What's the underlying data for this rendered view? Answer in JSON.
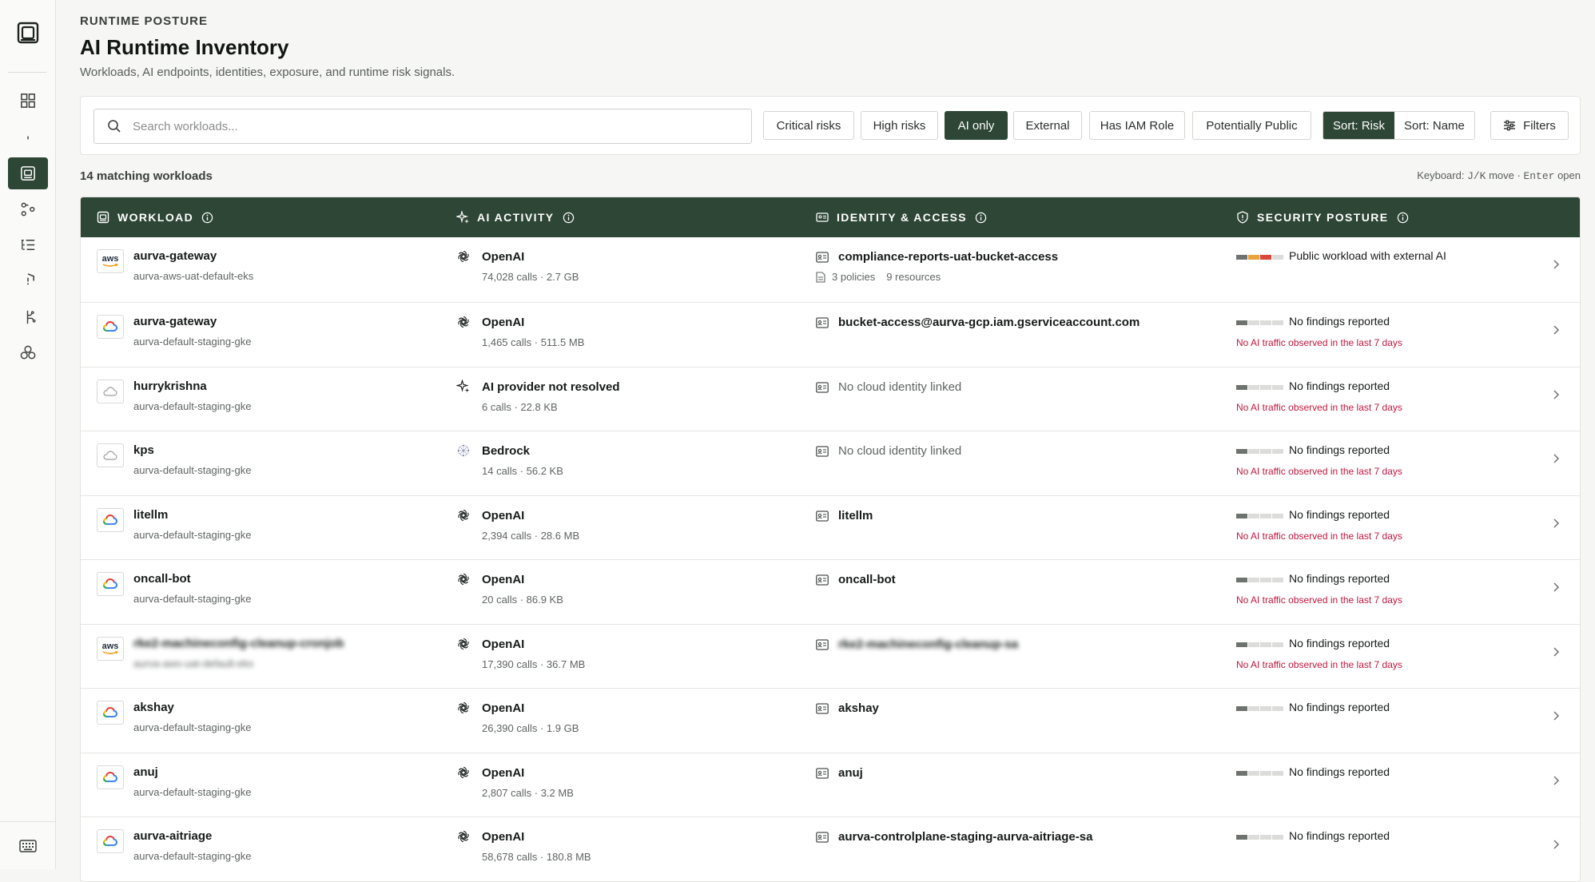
{
  "header": {
    "eyebrow": "RUNTIME POSTURE",
    "title": "AI Runtime Inventory",
    "subtitle": "Workloads, AI endpoints, identities, exposure, and runtime risk signals."
  },
  "search": {
    "placeholder": "Search workloads..."
  },
  "filters": [
    {
      "label": "Critical risks",
      "active": false
    },
    {
      "label": "High risks",
      "active": false
    },
    {
      "label": "AI only",
      "active": true
    },
    {
      "label": "External",
      "active": false
    },
    {
      "label": "Has IAM Role",
      "active": false
    },
    {
      "label": "Potentially Public",
      "active": false
    }
  ],
  "sort": {
    "risk_label": "Sort: Risk",
    "name_label": "Sort: Name",
    "active": "risk"
  },
  "filters_button": "Filters",
  "count_text": "14 matching workloads",
  "keyboard": {
    "prefix": "Keyboard: ",
    "keys": "J/K",
    "move": " move · ",
    "enter": "Enter",
    "open": " open"
  },
  "columns": {
    "workload": "WORKLOAD",
    "ai_activity": "AI ACTIVITY",
    "identity": "IDENTITY & ACCESS",
    "posture": "SECURITY POSTURE"
  },
  "colors": {
    "accent": "#2e4636",
    "warn": "#c0173f",
    "sev_red": "#d9463a",
    "sev_orange": "#e8a33c",
    "sev_dark": "#6e7370"
  },
  "rows": [
    {
      "provider": "aws",
      "name": "aurva-gateway",
      "cluster": "aurva-aws-uat-default-eks",
      "ai_icon": "openai-icon",
      "ai_name": "OpenAI",
      "ai_sub": "74,028 calls · 2.7 GB",
      "identity": "compliance-reports-uat-bucket-access",
      "identity_style": "bold",
      "policies": "3 policies",
      "resources": "9 resources",
      "severity": [
        "dark",
        "orange",
        "red",
        "light"
      ],
      "posture": "Public workload with external AI",
      "warn": ""
    },
    {
      "provider": "gcp",
      "name": "aurva-gateway",
      "cluster": "aurva-default-staging-gke",
      "ai_icon": "openai-icon",
      "ai_name": "OpenAI",
      "ai_sub": "1,465 calls · 511.5 MB",
      "identity": "bucket-access@aurva-gcp.iam.gserviceaccount.com",
      "identity_style": "bold",
      "severity": [
        "dark",
        "light",
        "light",
        "light"
      ],
      "posture": "No findings reported",
      "warn": "No AI traffic observed in the last 7 days"
    },
    {
      "provider": "cloud",
      "name": "hurrykrishna",
      "cluster": "aurva-default-staging-gke",
      "ai_icon": "sparkle-icon",
      "ai_name": "AI provider not resolved",
      "ai_sub": "6 calls · 22.8 KB",
      "identity": "No cloud identity linked",
      "identity_style": "muted",
      "severity": [
        "dark",
        "light",
        "light",
        "light"
      ],
      "posture": "No findings reported",
      "warn": "No AI traffic observed in the last 7 days"
    },
    {
      "provider": "cloud",
      "name": "kps",
      "cluster": "aurva-default-staging-gke",
      "ai_icon": "bedrock-icon",
      "ai_name": "Bedrock",
      "ai_sub": "14 calls · 56.2 KB",
      "identity": "No cloud identity linked",
      "identity_style": "muted",
      "severity": [
        "dark",
        "light",
        "light",
        "light"
      ],
      "posture": "No findings reported",
      "warn": "No AI traffic observed in the last 7 days"
    },
    {
      "provider": "gcp",
      "name": "litellm",
      "cluster": "aurva-default-staging-gke",
      "ai_icon": "openai-icon",
      "ai_name": "OpenAI",
      "ai_sub": "2,394 calls · 28.6 MB",
      "identity": "litellm",
      "identity_style": "bold",
      "severity": [
        "dark",
        "light",
        "light",
        "light"
      ],
      "posture": "No findings reported",
      "warn": "No AI traffic observed in the last 7 days"
    },
    {
      "provider": "gcp",
      "name": "oncall-bot",
      "cluster": "aurva-default-staging-gke",
      "ai_icon": "openai-icon",
      "ai_name": "OpenAI",
      "ai_sub": "20 calls · 86.9 KB",
      "identity": "oncall-bot",
      "identity_style": "bold",
      "severity": [
        "dark",
        "light",
        "light",
        "light"
      ],
      "posture": "No findings reported",
      "warn": "No AI traffic observed in the last 7 days"
    },
    {
      "provider": "aws",
      "name": "rke2-machineconfig-cleanup-cronjob",
      "cluster": "aurva-aws-uat-default-eks",
      "blurred": true,
      "ai_icon": "openai-icon",
      "ai_name": "OpenAI",
      "ai_sub": "17,390 calls · 36.7 MB",
      "identity": "rke2-machineconfig-cleanup-sa",
      "identity_style": "bold",
      "severity": [
        "dark",
        "light",
        "light",
        "light"
      ],
      "posture": "No findings reported",
      "warn": "No AI traffic observed in the last 7 days"
    },
    {
      "provider": "gcp",
      "name": "akshay",
      "cluster": "aurva-default-staging-gke",
      "ai_icon": "openai-icon",
      "ai_name": "OpenAI",
      "ai_sub": "26,390 calls · 1.9 GB",
      "identity": "akshay",
      "identity_style": "bold",
      "severity": [
        "dark",
        "light",
        "light",
        "light"
      ],
      "posture": "No findings reported",
      "warn": ""
    },
    {
      "provider": "gcp",
      "name": "anuj",
      "cluster": "aurva-default-staging-gke",
      "ai_icon": "openai-icon",
      "ai_name": "OpenAI",
      "ai_sub": "2,807 calls · 3.2 MB",
      "identity": "anuj",
      "identity_style": "bold",
      "severity": [
        "dark",
        "light",
        "light",
        "light"
      ],
      "posture": "No findings reported",
      "warn": ""
    },
    {
      "provider": "gcp",
      "name": "aurva-aitriage",
      "cluster": "aurva-default-staging-gke",
      "ai_icon": "openai-icon",
      "ai_name": "OpenAI",
      "ai_sub": "58,678 calls · 180.8 MB",
      "identity": "aurva-controlplane-staging-aurva-aitriage-sa",
      "identity_style": "bold",
      "severity": [
        "dark",
        "light",
        "light",
        "light"
      ],
      "posture": "No findings reported",
      "warn": ""
    }
  ],
  "sidebar": [
    {
      "icon": "dashboard-icon",
      "active": false
    },
    {
      "icon": "fingerprint-icon",
      "active": false
    },
    {
      "icon": "runtime-inventory-icon",
      "active": true
    },
    {
      "icon": "flow-icon",
      "active": false
    },
    {
      "icon": "list-icon",
      "active": false
    },
    {
      "icon": "shield-icon",
      "active": false
    },
    {
      "icon": "brain-icon",
      "active": false
    },
    {
      "icon": "clusters-icon",
      "active": false
    }
  ]
}
